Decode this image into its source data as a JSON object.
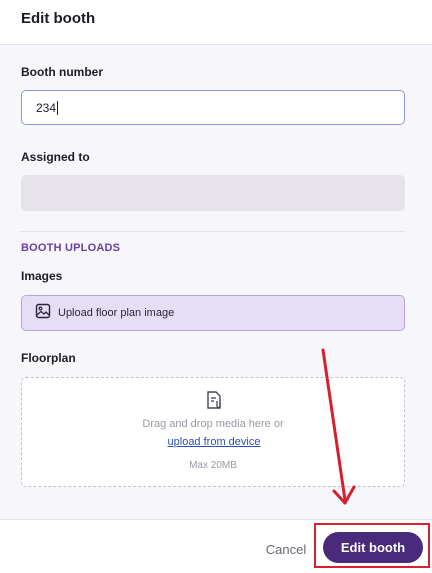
{
  "dialog": {
    "title": "Edit booth"
  },
  "form": {
    "booth_number_label": "Booth number",
    "booth_number_value": "234",
    "assigned_to_label": "Assigned to",
    "assigned_to_value": "",
    "section_heading": "BOOTH UPLOADS",
    "images_label": "Images",
    "images_button_label": "Upload floor plan image",
    "floorplan_label": "Floorplan",
    "dropzone": {
      "text": "Drag and drop media here or",
      "link": "upload from device",
      "max": "Max 20MB"
    }
  },
  "footer": {
    "cancel_label": "Cancel",
    "submit_label": "Edit booth"
  },
  "icons": {
    "image": "image-icon",
    "file": "file-attachment-icon"
  },
  "colors": {
    "primary": "#4a2a7a",
    "accent_text": "#6a3fa6",
    "input_border": "#8d98df",
    "annotation": "#d6202f"
  }
}
